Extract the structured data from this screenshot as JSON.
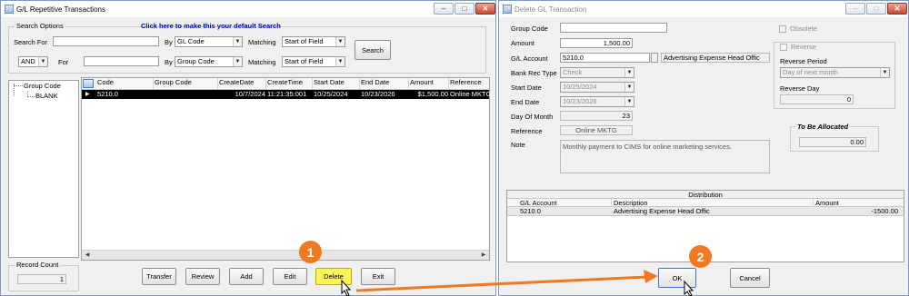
{
  "left_window": {
    "title": "G/L Repetitive Transactions",
    "search_options": {
      "group_label": "Search Options",
      "default_link": "Click here to make this your default Search",
      "search_for_label": "Search For",
      "by_label_1": "By",
      "by_value_1": "GL Code",
      "matching_label_1": "Matching",
      "matching_value_1": "Start of Field",
      "and_value": "AND",
      "for_label": "For",
      "by_label_2": "By",
      "by_value_2": "Group Code",
      "matching_label_2": "Matching",
      "matching_value_2": "Start of Field",
      "search_button": "Search"
    },
    "tree": {
      "root": "Group Code",
      "child": "BLANK"
    },
    "grid": {
      "columns": [
        "Code",
        "Group Code",
        "CreateDate",
        "CreateTime",
        "Start Date",
        "End Date",
        "Amount",
        "Reference"
      ],
      "rows": [
        {
          "code": "5210.0",
          "group_code": "",
          "create_date": "10/7/2024",
          "create_time": "11:21:35:001",
          "start_date": "10/25/2024",
          "end_date": "10/23/2026",
          "amount": "$1,500.00",
          "reference": "Online MKTG"
        }
      ]
    },
    "record_count_label": "Record Count",
    "record_count_value": "1",
    "buttons": {
      "transfer": "Transfer",
      "review": "Review",
      "add": "Add",
      "edit": "Edit",
      "delete": "Delete",
      "exit": "Exit"
    }
  },
  "right_window": {
    "title": "Delete GL Transaction",
    "labels": {
      "group_code": "Group Code",
      "amount": "Amount",
      "gl_account": "G/L Account",
      "bank_rec_type": "Bank Rec Type",
      "start_date": "Start Date",
      "end_date": "End Date",
      "day_of_month": "Day Of Month",
      "reference": "Reference",
      "note": "Note"
    },
    "values": {
      "group_code": "",
      "amount": "1,500.00",
      "gl_account": "5210.0",
      "gl_account_desc": "Advertising Expense Head Offic",
      "bank_rec_type": "Check",
      "start_date": "10/25/2024",
      "end_date": "10/23/2026",
      "day_of_month": "23",
      "reference": "Online MKTG",
      "note": "Monthly payment to CIMS for online marketing services."
    },
    "obsolete_label": "Obsolete",
    "reverse_label": "Reverse",
    "reverse_period_label": "Reverse Period",
    "reverse_period_value": "Day of next month",
    "reverse_day_label": "Reverse Day",
    "reverse_day_value": "0",
    "to_be_allocated_label": "To Be Allocated",
    "to_be_allocated_value": "0.00",
    "distribution": {
      "title": "Distribution",
      "columns": [
        "G/L Account",
        "Description",
        "Amount"
      ],
      "rows": [
        {
          "account": "5210.0",
          "description": "Advertising Expense Head Offic",
          "amount": "-1500.00"
        }
      ]
    },
    "buttons": {
      "ok": "OK",
      "cancel": "Cancel"
    }
  },
  "callouts": {
    "step1": "1",
    "step2": "2"
  },
  "colors": {
    "callout": "#ef7a21",
    "highlight": "#fbf35a",
    "link": "#0000cc",
    "selected_row": "#000000"
  }
}
